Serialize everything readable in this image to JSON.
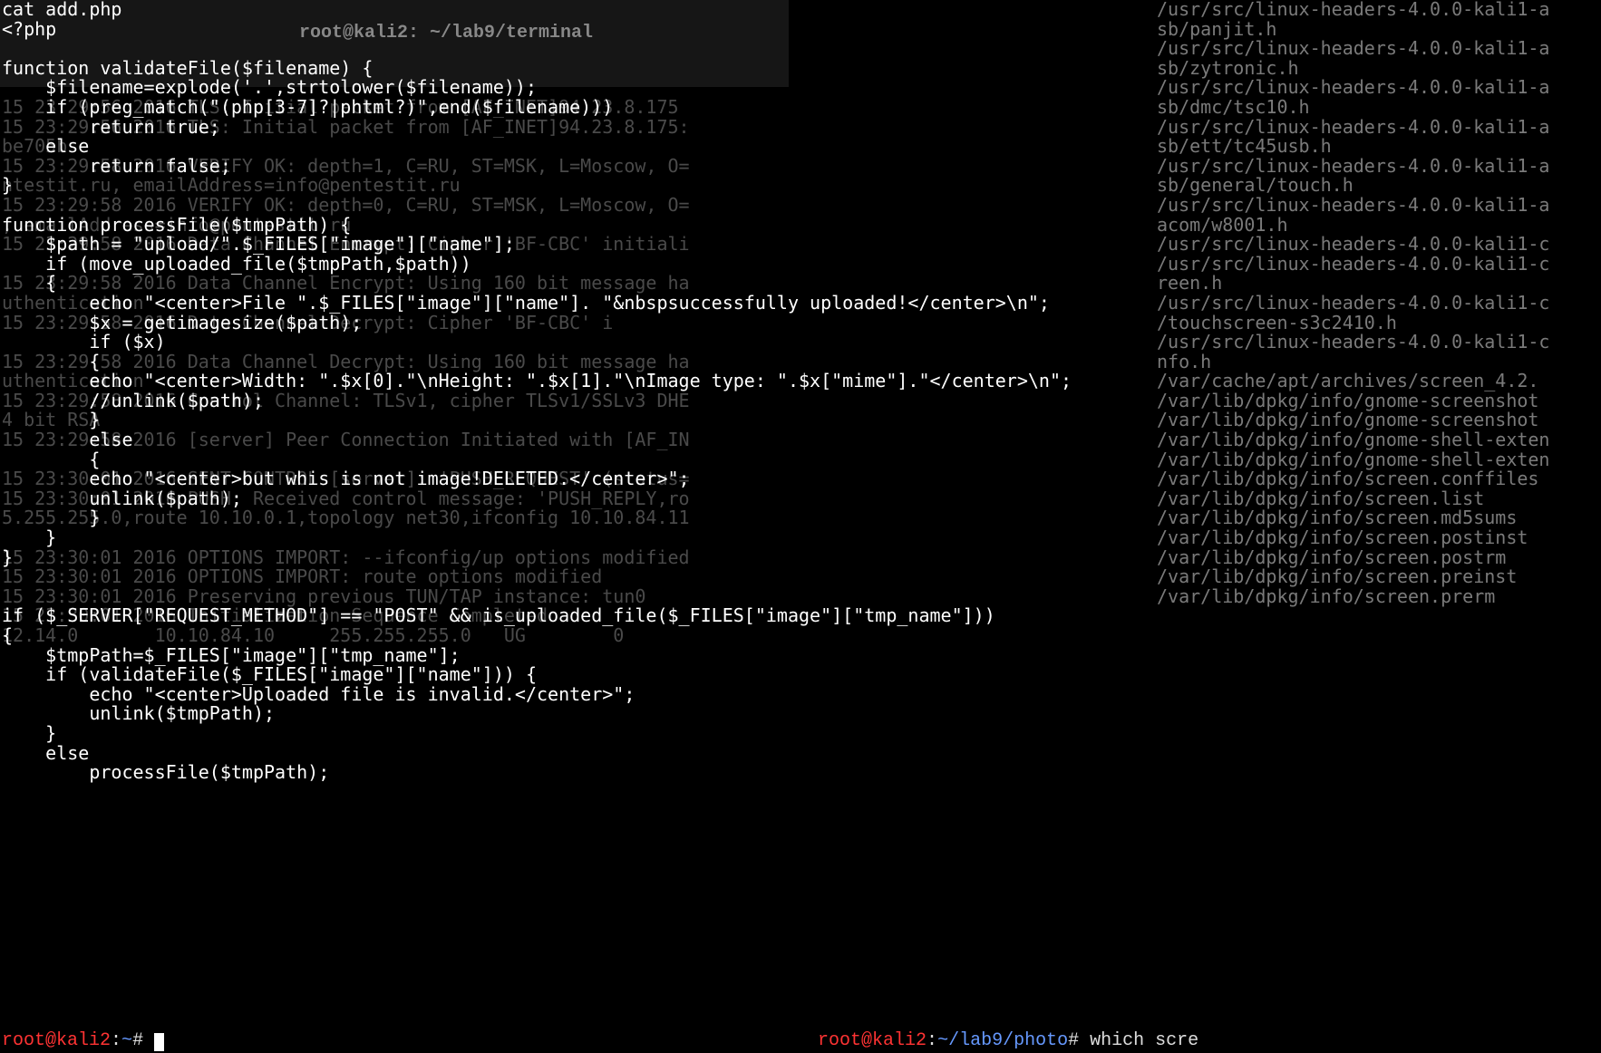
{
  "title": "root@kali2: ~/lab9/terminal",
  "fg_code": "cat add.php\n<?php\n\nfunction validateFile($filename) {\n    $filename=explode('.',strtolower($filename));\n    if (preg_match(\"(php[3-7]?|phtml?)\",end($filename)))\n        return true;\n    else\n        return false;\n}\n\nfunction processFile($tmpPath) {\n    $path = \"upload/\".$_FILES[\"image\"][\"name\"];\n    if (move_uploaded_file($tmpPath,$path))\n    {\n        echo \"<center>File \".$_FILES[\"image\"][\"name\"]. \"&nbspsuccessfully uploaded!</center>\\n\";\n        $x = getimagesize($path);\n        if ($x)\n        {\n        echo \"<center>Width: \".$x[0].\"\\nHeight: \".$x[1].\"\\nImage type: \".$x[\"mime\"].\"</center>\\n\";\n        //unlink($path);\n        }\n        else\n        {\n        echo \"<center>but whis is not image!DELETED.</center>\";\n        unlink($path);\n        }\n    }\n}\n\n\nif ($_SERVER[\"REQUEST_METHOD\"] == \"POST\" && is_uploaded_file($_FILES[\"image\"][\"tmp_name\"]))\n{\n    $tmpPath=$_FILES[\"image\"][\"tmp_name\"];\n    if (validateFile($_FILES[\"image\"][\"name\"])) {\n        echo \"<center>Uploaded file is invalid.</center>\";\n        unlink($tmpPath);\n    }\n    else\n        processFile($tmpPath);",
  "bg_text": "\n\n\n\n\n15 23:29:56 2016 TLS: Initial packet from [AF_INET]94.23.8.175\n15 23:29:56 2016 TLS: Initial packet from [AF_INET]94.23.8.175:\nbe705b\n15 23:29:58 2016 VERIFY OK: depth=1, C=RU, ST=MSK, L=Moscow, O=\nntestit.ru, emailAddress=info@pentestit.ru\n15 23:29:58 2016 VERIFY OK: depth=0, C=RU, ST=MSK, L=Moscow, O=\n, emailAddress=info@pentestit.ru\n15 23:29:58 2016 Data Channel Encrypt: Cipher 'BF-CBC' initiali\n\n15 23:29:58 2016 Data Channel Encrypt: Using 160 bit message ha\nuthentication\n15 23:29:58 2016 Data Channel Decrypt: Cipher 'BF-CBC' i\n\n15 23:29:58 2016 Data Channel Decrypt: Using 160 bit message ha\nuthentication\n15 23:29:58 2016 Control Channel: TLSv1, cipher TLSv1/SSLv3 DHE\n4 bit RSA\n15 23:29:58 2016 [server] Peer Connection Initiated with [AF_IN\n\n15 23:30:01 2016 SENT CONTROL [server]: 'PUSH_REQUEST' (status=\n15 23:30:01 2016 PUSH: Received control message: 'PUSH_REPLY,ro\n5.255.255.0,route 10.10.0.1,topology net30,ifconfig 10.10.84.11\n\n15 23:30:01 2016 OPTIONS IMPORT: --ifconfig/up options modified\n15 23:30:01 2016 OPTIONS IMPORT: route options modified\n15 23:30:01 2016 Preserving previous TUN/TAP instance: tun0\n15 23:30:01 2016 Initialization Sequence Completed\n12.14.0       10.10.84.10     255.255.255.0   UG        0 ",
  "right_panel": "/usr/src/linux-headers-4.0.0-kali1-a\nsb/panjit.h\n/usr/src/linux-headers-4.0.0-kali1-a\nsb/zytronic.h\n/usr/src/linux-headers-4.0.0-kali1-a\nsb/dmc/tsc10.h\n/usr/src/linux-headers-4.0.0-kali1-a\nsb/ett/tc45usb.h\n/usr/src/linux-headers-4.0.0-kali1-a\nsb/general/touch.h\n/usr/src/linux-headers-4.0.0-kali1-a\nacom/w8001.h\n/usr/src/linux-headers-4.0.0-kali1-c\n/usr/src/linux-headers-4.0.0-kali1-c\nreen.h\n/usr/src/linux-headers-4.0.0-kali1-c\n/touchscreen-s3c2410.h\n/usr/src/linux-headers-4.0.0-kali1-c\nnfo.h\n/var/cache/apt/archives/screen_4.2.\n/var/lib/dpkg/info/gnome-screenshot\n/var/lib/dpkg/info/gnome-screenshot\n/var/lib/dpkg/info/gnome-shell-exten\n/var/lib/dpkg/info/gnome-shell-exten\n/var/lib/dpkg/info/screen.conffiles\n/var/lib/dpkg/info/screen.list\n/var/lib/dpkg/info/screen.md5sums\n/var/lib/dpkg/info/screen.postinst\n/var/lib/dpkg/info/screen.postrm\n/var/lib/dpkg/info/screen.preinst\n/var/lib/dpkg/info/screen.prerm",
  "bottom_prompt": {
    "user": "root@kali2",
    "sep": ":",
    "path": "~",
    "hash": "# "
  },
  "right_prompt": {
    "user": "root@kali2",
    "sep": ":",
    "path": "~/lab9/photo",
    "hash": "# ",
    "cmd": "which scre"
  }
}
